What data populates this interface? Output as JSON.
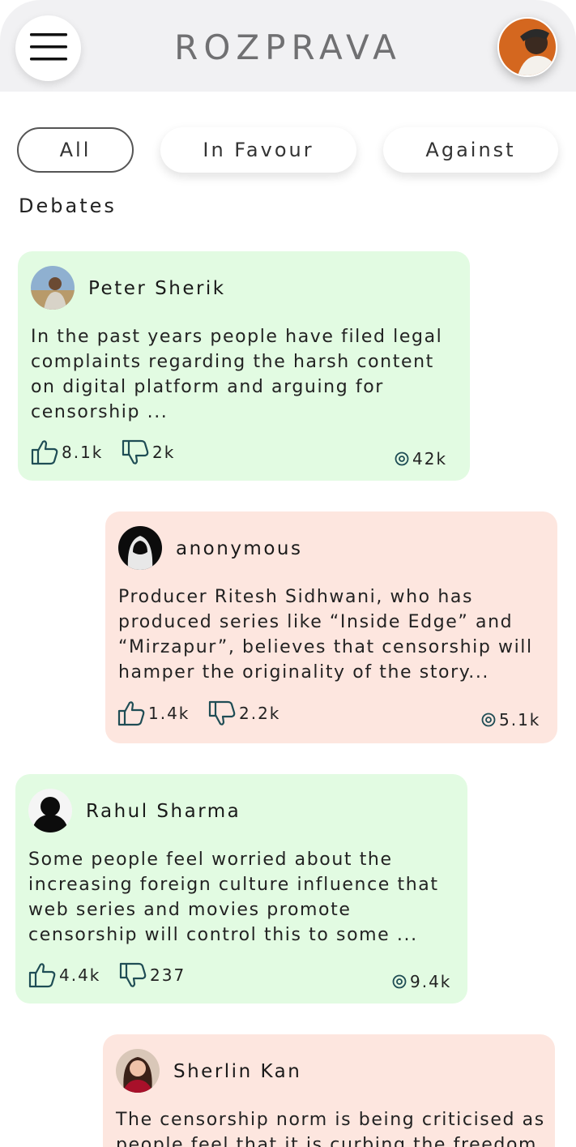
{
  "app": {
    "title": "ROZPRAVA"
  },
  "filters": [
    {
      "label": "All",
      "active": true
    },
    {
      "label": "In Favour",
      "active": false
    },
    {
      "label": "Against",
      "active": false
    }
  ],
  "section_title": "Debates",
  "debates": [
    {
      "author": "Peter Sherik",
      "stance": "favour",
      "text": "In the past years people have filed legal complaints regarding the harsh content on digital platform and arguing for censorship ...",
      "likes": "8.1k",
      "dislikes": "2k",
      "views": "42k"
    },
    {
      "author": "anonymous",
      "stance": "against",
      "text": "Producer Ritesh Sidhwani, who has produced series like “Inside Edge” and “Mirzapur”, believes that censorship will hamper the originality of the story...",
      "likes": "1.4k",
      "dislikes": "2.2k",
      "views": "5.1k"
    },
    {
      "author": "Rahul Sharma",
      "stance": "favour",
      "text": "Some people feel worried about the increasing foreign culture influence that web series and movies promote censorship will control this to some ...",
      "likes": "4.4k",
      "dislikes": "237",
      "views": "9.4k"
    },
    {
      "author": "Sherlin Kan",
      "stance": "against",
      "text": "The censorship norm is being criticised as people feel that it is curbing the freedom",
      "likes": "",
      "dislikes": "",
      "views": ""
    }
  ],
  "colors": {
    "favour_bg": "#e2fbe2",
    "against_bg": "#fde6df",
    "header_bg": "#f1f1f3"
  },
  "icons": {
    "menu": "hamburger-icon",
    "like": "thumbs-up-icon",
    "dislike": "thumbs-down-icon",
    "views": "eye-icon"
  }
}
